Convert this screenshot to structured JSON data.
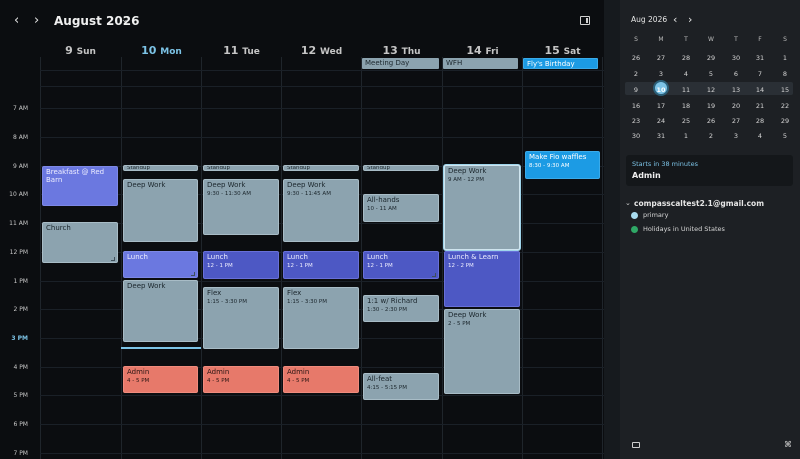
{
  "header": {
    "month_title": "August 2026",
    "days": [
      {
        "num": "9",
        "name": "Sun"
      },
      {
        "num": "10",
        "name": "Mon"
      },
      {
        "num": "11",
        "name": "Tue"
      },
      {
        "num": "12",
        "name": "Wed"
      },
      {
        "num": "13",
        "name": "Thu"
      },
      {
        "num": "14",
        "name": "Fri"
      },
      {
        "num": "15",
        "name": "Sat"
      }
    ]
  },
  "times": [
    "7 AM",
    "8 AM",
    "9 AM",
    "10 AM",
    "11 AM",
    "12 PM",
    "1 PM",
    "2 PM",
    "3 PM",
    "4 PM",
    "5 PM",
    "6 PM",
    "7 PM"
  ],
  "all_day_events": [
    {
      "title": "Meeting Day",
      "day": "Thu"
    },
    {
      "title": "WFH",
      "day": "Fri"
    },
    {
      "title": "Fly's Birthday",
      "day": "Sat"
    }
  ],
  "events": {
    "breakfast": {
      "title": "Breakfast @ Red Barn"
    },
    "church": {
      "title": "Church"
    },
    "standup_mon": {
      "title": "Standup"
    },
    "standup_tue": {
      "title": "Standup"
    },
    "standup_wed": {
      "title": "Standup"
    },
    "standup_thu": {
      "title": "Standup"
    },
    "deepwork_mon": {
      "title": "Deep Work"
    },
    "deepwork_tue": {
      "title": "Deep Work",
      "time": "9:30 - 11:30 AM"
    },
    "deepwork_wed": {
      "title": "Deep Work",
      "time": "9:30 - 11:45 AM"
    },
    "allhands": {
      "title": "All-hands",
      "time": "10 - 11 AM"
    },
    "deepwork_fri": {
      "title": "Deep Work",
      "time": "9 AM - 12 PM"
    },
    "waffles": {
      "title": "Make Fio waffles",
      "time": "8:30 - 9:30 AM"
    },
    "lunch_mon": {
      "title": "Lunch"
    },
    "lunch_tue": {
      "title": "Lunch",
      "time": "12 - 1 PM"
    },
    "lunch_wed": {
      "title": "Lunch",
      "time": "12 - 1 PM"
    },
    "lunch_thu": {
      "title": "Lunch",
      "time": "12 - 1 PM"
    },
    "lunchlearn": {
      "title": "Lunch & Learn",
      "time": "12 - 2 PM"
    },
    "deepwork_mon2": {
      "title": "Deep Work"
    },
    "flex_tue": {
      "title": "Flex",
      "time": "1:15 - 3:30 PM"
    },
    "flex_wed": {
      "title": "Flex",
      "time": "1:15 - 3:30 PM"
    },
    "oneonone": {
      "title": "1:1 w/ Richard",
      "time": "1:30 - 2:30 PM"
    },
    "deepwork_fri2": {
      "title": "Deep Work",
      "time": "2 - 5 PM"
    },
    "admin_mon": {
      "title": "Admin",
      "time": "4 - 5 PM"
    },
    "admin_tue": {
      "title": "Admin",
      "time": "4 - 5 PM"
    },
    "admin_wed": {
      "title": "Admin",
      "time": "4 - 5 PM"
    },
    "allfeat": {
      "title": "All-feat",
      "time": "4:15 - 5:15 PM"
    }
  },
  "sidebar": {
    "month_title": "Aug 2026",
    "weekday_headers": [
      "S",
      "M",
      "T",
      "W",
      "T",
      "F",
      "S"
    ],
    "weeks": [
      [
        "26",
        "27",
        "28",
        "29",
        "30",
        "31",
        "1"
      ],
      [
        "2",
        "3",
        "4",
        "5",
        "6",
        "7",
        "8"
      ],
      [
        "9",
        "10",
        "11",
        "12",
        "13",
        "14",
        "15"
      ],
      [
        "16",
        "17",
        "18",
        "19",
        "20",
        "21",
        "22"
      ],
      [
        "23",
        "24",
        "25",
        "26",
        "27",
        "28",
        "29"
      ],
      [
        "30",
        "31",
        "1",
        "2",
        "3",
        "4",
        "5"
      ]
    ],
    "upcoming_label": "Starts in 38 minutes",
    "upcoming_title": "Admin",
    "account": "compasscaltest2.1@gmail.com",
    "calendars": [
      {
        "name": "primary",
        "color": "#a9dcef"
      },
      {
        "name": "Holidays in United States",
        "color": "#2fa866"
      }
    ]
  },
  "colors": {
    "accent": "#7cc3e6",
    "event_grey": "#8ca3af",
    "event_blue": "#4d58c4",
    "event_salmon": "#e7796a",
    "event_sky": "#1c9be4"
  }
}
